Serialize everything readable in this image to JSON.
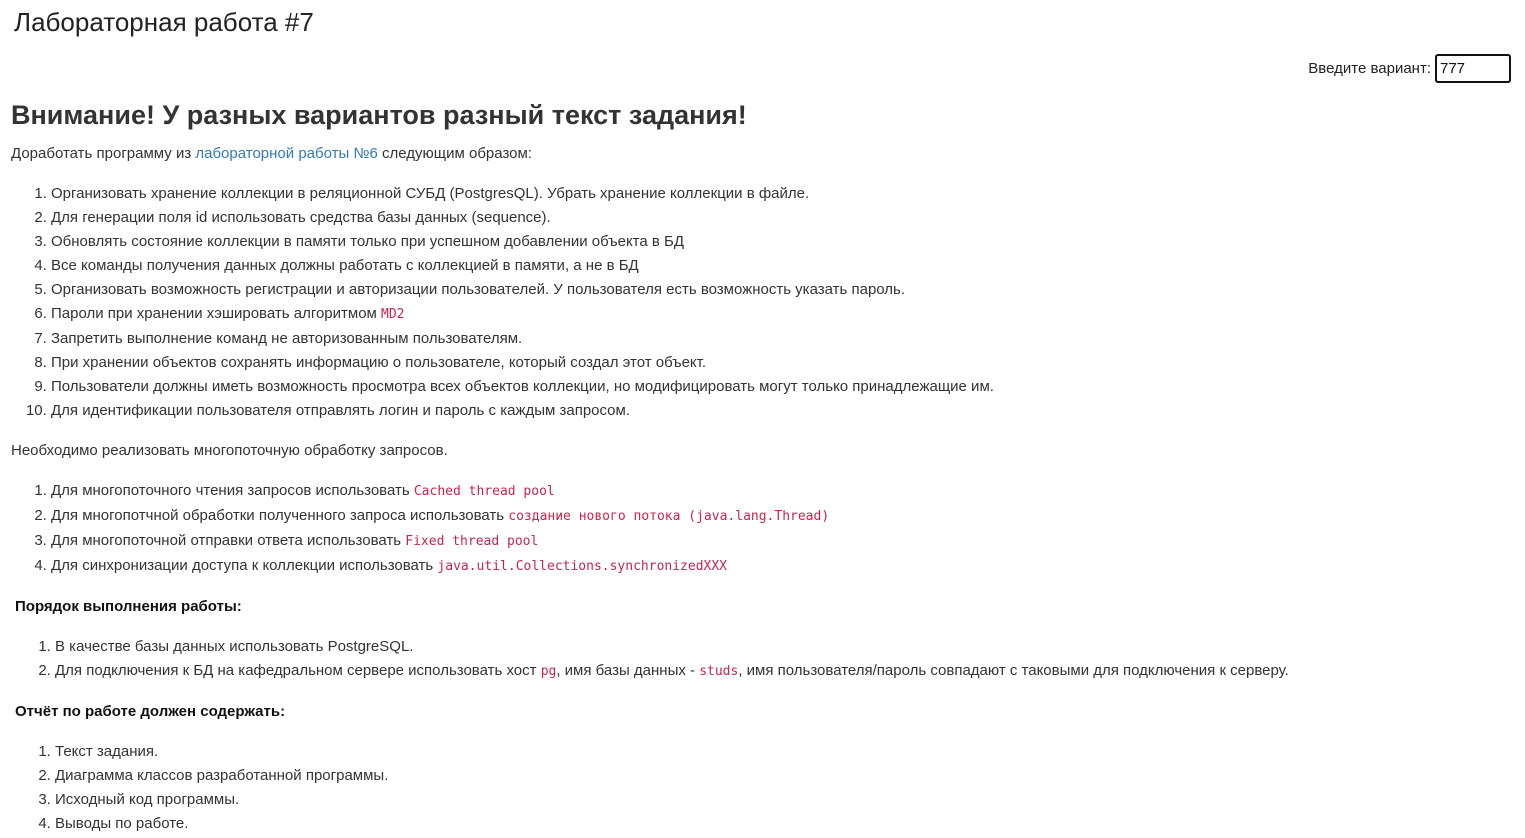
{
  "header": {
    "title": "Лабораторная работа #7"
  },
  "variant": {
    "label": "Введите вариант:",
    "value": "777"
  },
  "warning": "Внимание! У разных вариантов разный текст задания!",
  "intro": {
    "before": "Доработать программу из ",
    "link": "лабораторной работы №6",
    "after": " следующим образом:"
  },
  "tasks": [
    {
      "text": "Организовать хранение коллекции в реляционной СУБД (PostgresQL). Убрать хранение коллекции в файле.",
      "code": ""
    },
    {
      "text": "Для генерации поля id использовать средства базы данных (sequence).",
      "code": ""
    },
    {
      "text": "Обновлять состояние коллекции в памяти только при успешном добавлении объекта в БД",
      "code": ""
    },
    {
      "text": "Все команды получения данных должны работать с коллекцией в памяти, а не в БД",
      "code": ""
    },
    {
      "text": "Организовать возможность регистрации и авторизации пользователей. У пользователя есть возможность указать пароль.",
      "code": ""
    },
    {
      "text": "Пароли при хранении хэшировать алгоритмом ",
      "code": "MD2"
    },
    {
      "text": "Запретить выполнение команд не авторизованным пользователям.",
      "code": ""
    },
    {
      "text": "При хранении объектов сохранять информацию о пользователе, который создал этот объект.",
      "code": ""
    },
    {
      "text": "Пользователи должны иметь возможность просмотра всех объектов коллекции, но модифицировать могут только принадлежащие им.",
      "code": ""
    },
    {
      "text": "Для идентификации пользователя отправлять логин и пароль с каждым запросом.",
      "code": ""
    }
  ],
  "multithread_intro": "Необходимо реализовать многопоточную обработку запросов.",
  "multithread": [
    {
      "text": "Для многопоточного чтения запросов использовать ",
      "code": "Cached thread pool"
    },
    {
      "text": "Для многопотчной обработки полученного запроса использовать ",
      "code": "создание нового потока (java.lang.Thread)"
    },
    {
      "text": "Для многопоточной отправки ответа использовать ",
      "code": "Fixed thread pool"
    },
    {
      "text": "Для синхронизации доступа к коллекции использовать ",
      "code": "java.util.Collections.synchronizedXXX"
    }
  ],
  "order": {
    "heading": "Порядок выполнения работы:",
    "item1": "В качестве базы данных использовать PostgreSQL.",
    "item2": {
      "part1": "Для подключения к БД на кафедральном сервере использовать хост ",
      "code1": "pg",
      "part2": ", имя базы данных - ",
      "code2": "studs",
      "part3": ", имя пользователя/пароль совпадают с таковыми для подключения к серверу."
    }
  },
  "report": {
    "heading": "Отчёт по работе должен содержать:",
    "items": [
      "Текст задания.",
      "Диаграмма классов разработанной программы.",
      "Исходный код программы.",
      "Выводы по работе."
    ]
  }
}
